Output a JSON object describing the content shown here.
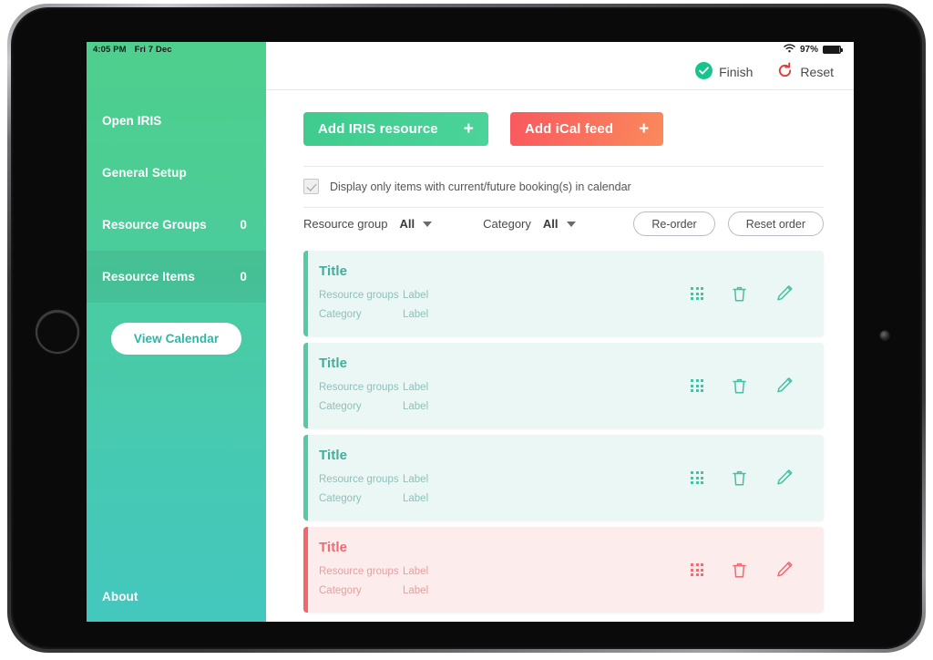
{
  "status_bar": {
    "time": "4:05 PM",
    "date": "Fri 7 Dec",
    "wifi_icon": "wifi-icon",
    "battery_percent": "97%"
  },
  "sidebar": {
    "items": [
      {
        "label": "Open IRIS",
        "count": "",
        "selected": false
      },
      {
        "label": "General Setup",
        "count": "",
        "selected": false
      },
      {
        "label": "Resource Groups",
        "count": "0",
        "selected": false
      },
      {
        "label": "Resource Items",
        "count": "0",
        "selected": true
      }
    ],
    "calendar_button": "View Calendar",
    "about_label": "About"
  },
  "topbar": {
    "finish_label": "Finish",
    "finish_icon": "check-circle-icon",
    "reset_label": "Reset",
    "reset_icon": "refresh-icon"
  },
  "actions": {
    "add_iris_label": "Add IRIS resource",
    "add_ical_label": "Add iCal feed",
    "plus": "+"
  },
  "filter_checkbox": {
    "label": "Display only items with current/future booking(s) in calendar",
    "checked": true
  },
  "filters": {
    "resource_group_label": "Resource group",
    "resource_group_value": "All",
    "category_label": "Category",
    "category_value": "All",
    "reorder_label": "Re-order",
    "reset_order_label": "Reset order"
  },
  "cards": [
    {
      "title": "Title",
      "resource_groups_key": "Resource groups",
      "resource_groups_value": "Label",
      "category_key": "Category",
      "category_value": "Label",
      "state": "green"
    },
    {
      "title": "Title",
      "resource_groups_key": "Resource groups",
      "resource_groups_value": "Label",
      "category_key": "Category",
      "category_value": "Label",
      "state": "green"
    },
    {
      "title": "Title",
      "resource_groups_key": "Resource groups",
      "resource_groups_value": "Label",
      "category_key": "Category",
      "category_value": "Label",
      "state": "green"
    },
    {
      "title": "Title",
      "resource_groups_key": "Resource groups",
      "resource_groups_value": "Label",
      "category_key": "Category",
      "category_value": "Label",
      "state": "red"
    }
  ],
  "card_icons": {
    "drag": "grid-drag-icon",
    "delete": "trash-icon",
    "edit": "pencil-icon"
  },
  "colors": {
    "brand_green": "#4ecf8d",
    "brand_teal": "#44c7bd",
    "accent_red": "#f4666c",
    "card_green_bg": "#eaf7f4",
    "card_red_bg": "#fcecec"
  }
}
